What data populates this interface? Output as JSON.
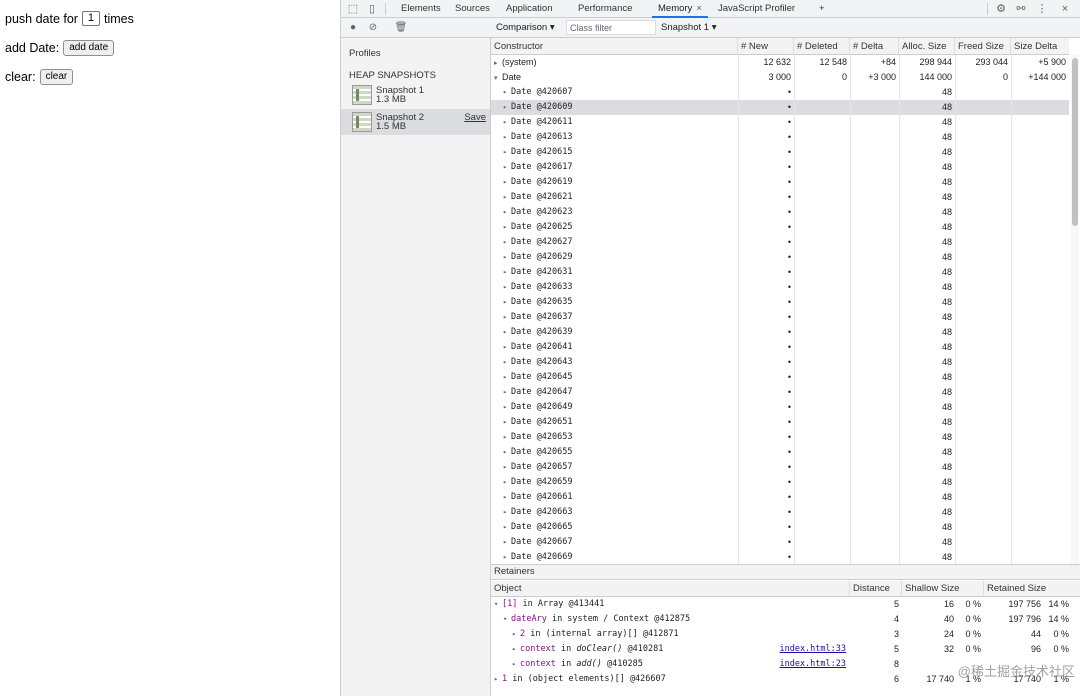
{
  "demo": {
    "push_label": "push date for",
    "push_count": "1",
    "push_suffix": "times",
    "add_label": "add Date:",
    "add_button": "add date",
    "clear_label": "clear:",
    "clear_button": "clear"
  },
  "devtools": {
    "tabs": [
      "Elements",
      "Sources",
      "Application",
      "Performance",
      "Memory",
      "JavaScript Profiler"
    ],
    "active_tab": "Memory",
    "new_tab_symbol": "+",
    "comparison_select": "Comparison",
    "class_filter_placeholder": "Class filter",
    "snapshot_select": "Snapshot 1",
    "sidebar": {
      "profiles_label": "Profiles",
      "heap_snapshots_label": "HEAP SNAPSHOTS",
      "snapshots": [
        {
          "name": "Snapshot 1",
          "size": "1.3 MB"
        },
        {
          "name": "Snapshot 2",
          "size": "1.5 MB",
          "save": "Save"
        }
      ]
    },
    "table": {
      "columns": [
        "Constructor",
        "# New",
        "# Deleted",
        "# Delta",
        "Alloc. Size",
        "Freed Size",
        "Size Delta"
      ],
      "summary_rows": [
        {
          "name": "(system)",
          "new": "12 632",
          "deleted": "12 548",
          "delta": "+84",
          "alloc": "298 944",
          "freed": "293 044",
          "size_delta": "+5 900"
        },
        {
          "name": "Date",
          "new": "3 000",
          "deleted": "0",
          "delta": "+3 000",
          "alloc": "144 000",
          "freed": "0",
          "size_delta": "+144 000"
        }
      ],
      "date_ids": [
        "@420607",
        "@420609",
        "@420611",
        "@420613",
        "@420615",
        "@420617",
        "@420619",
        "@420621",
        "@420623",
        "@420625",
        "@420627",
        "@420629",
        "@420631",
        "@420633",
        "@420635",
        "@420637",
        "@420639",
        "@420641",
        "@420643",
        "@420645",
        "@420647",
        "@420649",
        "@420651",
        "@420653",
        "@420655",
        "@420657",
        "@420659",
        "@420661",
        "@420663",
        "@420665",
        "@420667",
        "@420669"
      ],
      "date_label": "Date",
      "new_marker": "•",
      "alloc_each": "48",
      "selected_row": "@420609"
    },
    "retainers": {
      "title": "Retainers",
      "columns": [
        "Object",
        "Distance",
        "Shallow Size",
        "Retained Size"
      ],
      "rows": [
        {
          "prefix": "[1]",
          "rest": " in Array @413441",
          "distance": "5",
          "shallow": "16",
          "shallow_pct": "0 %",
          "retained": "197 756",
          "retained_pct": "14 %"
        },
        {
          "prefix": "dateAry",
          "rest": " in system / Context @412875",
          "distance": "4",
          "shallow": "40",
          "shallow_pct": "0 %",
          "retained": "197 796",
          "retained_pct": "14 %"
        },
        {
          "prefix": "2",
          "rest": " in (internal array)[] @412871",
          "distance": "3",
          "shallow": "24",
          "shallow_pct": "0 %",
          "retained": "44",
          "retained_pct": "0 %"
        },
        {
          "prefix": "context",
          "mid": " in ",
          "fn": "doClear()",
          "rest": " @410281",
          "link": "index.html:33",
          "distance": "5",
          "shallow": "32",
          "shallow_pct": "0 %",
          "retained": "96",
          "retained_pct": "0 %"
        },
        {
          "prefix": "context",
          "mid": " in ",
          "fn": "add()",
          "rest": " @410285",
          "link": "index.html:23",
          "distance": "8",
          "shallow": "",
          "shallow_pct": "",
          "retained": "",
          "retained_pct": ""
        },
        {
          "prefix": "1",
          "rest": " in (object elements)[] @426607",
          "distance": "6",
          "shallow": "17 740",
          "shallow_pct": "1 %",
          "retained": "17 740",
          "retained_pct": "1 %"
        }
      ]
    },
    "watermark": "@稀土掘金技术社区"
  }
}
